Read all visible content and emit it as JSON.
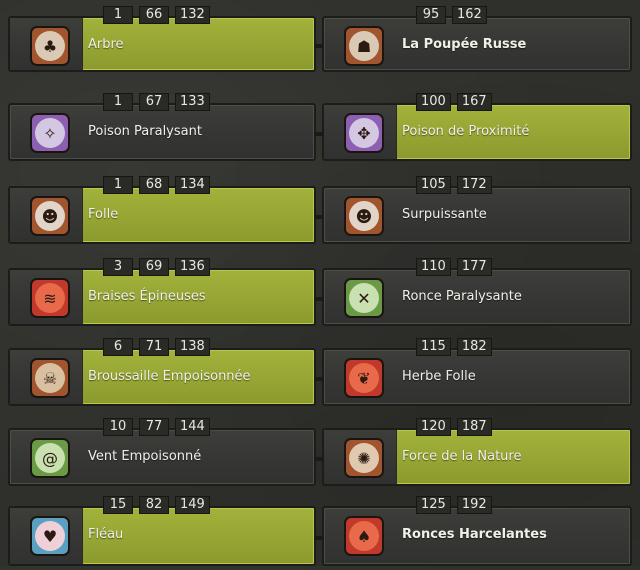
{
  "spells": [
    {
      "left": {
        "levels": [
          "1",
          "66",
          "132"
        ],
        "name": "Arbre",
        "icon": "tree-icon",
        "icon_bg": "#a0552f",
        "inner_bg": "#d9c9b5",
        "glyph": "♣",
        "active": true
      },
      "right": {
        "levels": [
          "95",
          "162"
        ],
        "name": "La Poupée Russe",
        "icon": "matryoshka-icon",
        "icon_bg": "#a0552f",
        "inner_bg": "#d9c9b5",
        "glyph": "☗",
        "active": false
      }
    },
    {
      "left": {
        "levels": [
          "1",
          "67",
          "133"
        ],
        "name": "Poison Paralysant",
        "icon": "poison-icon",
        "icon_bg": "#8c5fb0",
        "inner_bg": "#d4c7e2",
        "glyph": "✧",
        "active": false
      },
      "right": {
        "levels": [
          "100",
          "167"
        ],
        "name": "Poison de Proximité",
        "icon": "proximity-poison-icon",
        "icon_bg": "#8c5fb0",
        "inner_bg": "#d4c7e2",
        "glyph": "✥",
        "active": true
      }
    },
    {
      "left": {
        "levels": [
          "1",
          "68",
          "134"
        ],
        "name": "Folle",
        "icon": "sheep-icon",
        "icon_bg": "#a0552f",
        "inner_bg": "#e0d5c8",
        "glyph": "☻",
        "active": true
      },
      "right": {
        "levels": [
          "105",
          "172"
        ],
        "name": "Surpuissante",
        "icon": "beast-icon",
        "icon_bg": "#a0552f",
        "inner_bg": "#e0d5c8",
        "glyph": "☻",
        "active": false
      }
    },
    {
      "left": {
        "levels": [
          "3",
          "69",
          "136"
        ],
        "name": "Braises Épineuses",
        "icon": "ember-icon",
        "icon_bg": "#c0392b",
        "inner_bg": "#e86a4a",
        "glyph": "≋",
        "active": true
      },
      "right": {
        "levels": [
          "110",
          "177"
        ],
        "name": "Ronce Paralysante",
        "icon": "bramble-icon",
        "icon_bg": "#6a9a45",
        "inner_bg": "#c9e0b0",
        "glyph": "✕",
        "active": false
      }
    },
    {
      "left": {
        "levels": [
          "6",
          "71",
          "138"
        ],
        "name": "Broussaille Empoisonnée",
        "icon": "poisoned-bush-icon",
        "icon_bg": "#a0552f",
        "inner_bg": "#d9c0a0",
        "glyph": "☠",
        "active": true
      },
      "right": {
        "levels": [
          "115",
          "182"
        ],
        "name": "Herbe Folle",
        "icon": "wild-grass-icon",
        "icon_bg": "#c0392b",
        "inner_bg": "#e86a4a",
        "glyph": "❦",
        "active": false
      }
    },
    {
      "left": {
        "levels": [
          "10",
          "77",
          "144"
        ],
        "name": "Vent Empoisonné",
        "icon": "poison-wind-icon",
        "icon_bg": "#6a9a45",
        "inner_bg": "#c9e0b0",
        "glyph": "@",
        "active": false
      },
      "right": {
        "levels": [
          "120",
          "187"
        ],
        "name": "Force de la Nature",
        "icon": "nature-force-icon",
        "icon_bg": "#a0552f",
        "inner_bg": "#e0c9b0",
        "glyph": "✺",
        "active": true
      }
    },
    {
      "left": {
        "levels": [
          "15",
          "82",
          "149"
        ],
        "name": "Fléau",
        "icon": "scourge-icon",
        "icon_bg": "#5aa0c0",
        "inner_bg": "#f0d0d8",
        "glyph": "♥",
        "active": true
      },
      "right": {
        "levels": [
          "125",
          "192"
        ],
        "name": "Ronces Harcelantes",
        "icon": "harassing-brambles-icon",
        "icon_bg": "#c0392b",
        "inner_bg": "#e86a4a",
        "glyph": "♠",
        "active": false
      }
    }
  ]
}
